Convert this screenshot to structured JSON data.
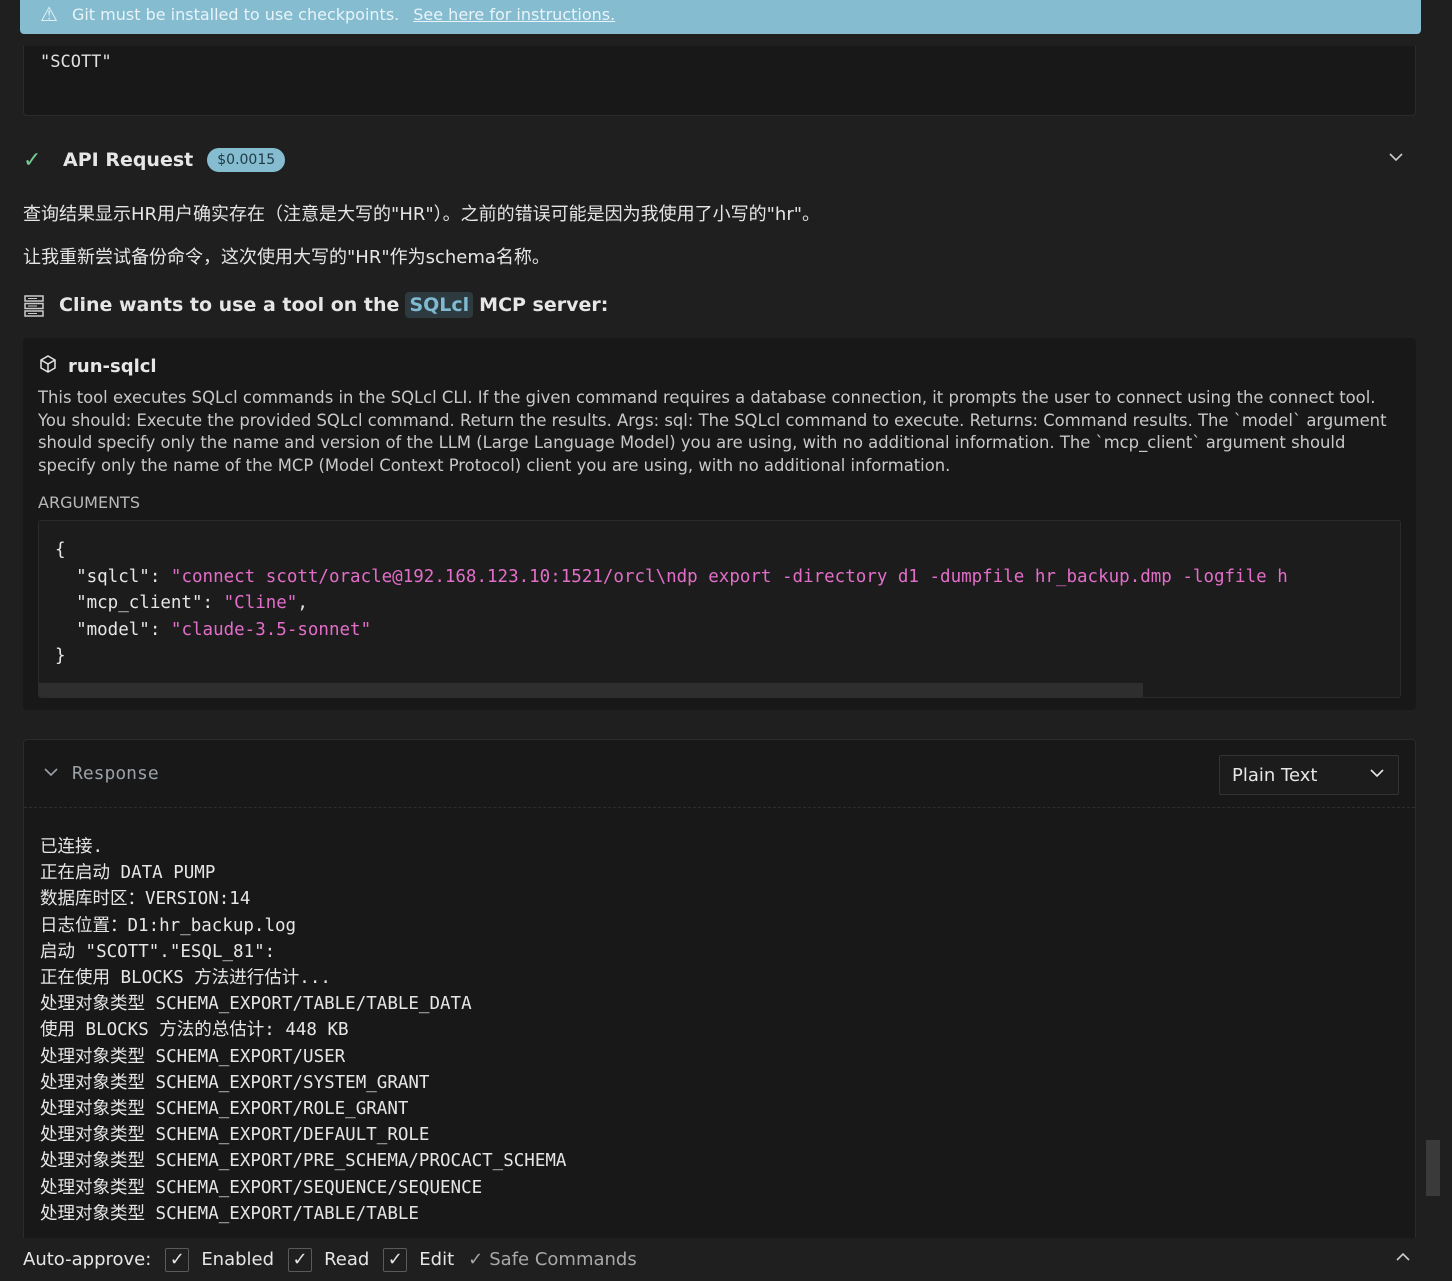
{
  "banner": {
    "icon": "warning-icon",
    "text": "Git must be installed to use checkpoints.",
    "link": "See here for instructions."
  },
  "prev_output": "\"SCOTT\"",
  "api_request": {
    "title": "API Request",
    "cost": "$0.0015"
  },
  "messages": [
    "查询结果显示HR用户确实存在（注意是大写的\"HR\"）。之前的错误可能是因为我使用了小写的\"hr\"。",
    "让我重新尝试备份命令，这次使用大写的\"HR\"作为schema名称。"
  ],
  "mcp": {
    "prefix": "Cline wants to use a tool on the",
    "server": "SQLcl",
    "suffix": "MCP server:"
  },
  "tool": {
    "name": "run-sqlcl",
    "description": "This tool executes SQLcl commands in the SQLcl CLI. If the given command requires a database connection, it prompts the user to connect using the connect tool. You should: Execute the provided SQLcl command. Return the results. Args: sql: The SQLcl command to execute. Returns: Command results. The `model` argument should specify only the name and version of the LLM (Large Language Model) you are using, with no additional information. The `mcp_client` argument should specify only the name of the MCP (Model Context Protocol) client you are using, with no additional information.",
    "arguments_label": "ARGUMENTS",
    "args": {
      "sqlcl_key": "\"sqlcl\"",
      "sqlcl_val": "\"connect scott/oracle@192.168.123.10:1521/orcl\\ndp export -directory d1 -dumpfile hr_backup.dmp -logfile h",
      "mcp_client_key": "\"mcp_client\"",
      "mcp_client_val": "\"Cline\"",
      "model_key": "\"model\"",
      "model_val": "\"claude-3.5-sonnet\""
    }
  },
  "response": {
    "title": "Response",
    "format": "Plain Text",
    "lines": [
      "已连接.",
      "正在启动 DATA PUMP",
      "数据库时区：VERSION:14",
      "日志位置：D1:hr_backup.log",
      "启动 \"SCOTT\".\"ESQL_81\":",
      "正在使用 BLOCKS 方法进行估计...",
      "处理对象类型 SCHEMA_EXPORT/TABLE/TABLE_DATA",
      "使用 BLOCKS 方法的总估计: 448 KB",
      "处理对象类型 SCHEMA_EXPORT/USER",
      "处理对象类型 SCHEMA_EXPORT/SYSTEM_GRANT",
      "处理对象类型 SCHEMA_EXPORT/ROLE_GRANT",
      "处理对象类型 SCHEMA_EXPORT/DEFAULT_ROLE",
      "处理对象类型 SCHEMA_EXPORT/PRE_SCHEMA/PROCACT_SCHEMA",
      "处理对象类型 SCHEMA_EXPORT/SEQUENCE/SEQUENCE",
      "处理对象类型 SCHEMA_EXPORT/TABLE/TABLE"
    ]
  },
  "auto_approve": {
    "label": "Auto-approve:",
    "items": [
      {
        "label": "Enabled",
        "checked": true
      },
      {
        "label": "Read",
        "checked": true
      },
      {
        "label": "Edit",
        "checked": true
      }
    ],
    "safe_commands": "Safe Commands"
  }
}
